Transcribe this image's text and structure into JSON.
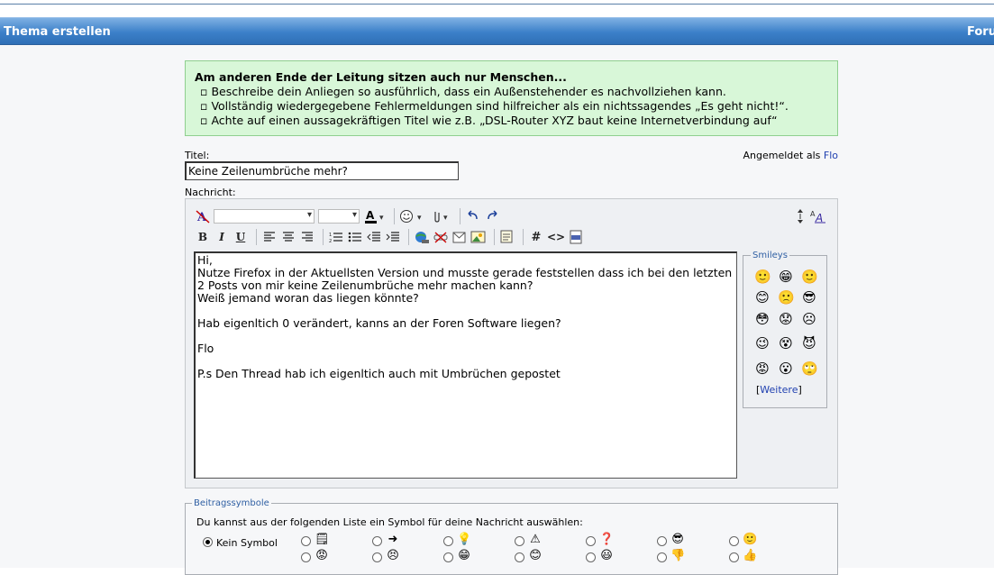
{
  "window": {
    "title": "Thema erstellen",
    "right_tab": "Foru"
  },
  "notice": {
    "heading": "Am anderen Ende der Leitung sitzen auch nur Menschen...",
    "items": [
      "Beschreibe dein Anliegen so ausführlich, dass ein Außenstehender es nachvollziehen kann.",
      "Vollständig wiedergegebene Fehlermeldungen sind hilfreicher als ein nichtssagendes „Es geht nicht!“.",
      "Achte auf einen aussagekräftigen Titel wie z.B. „DSL-Router XYZ baut keine Internetverbindung auf“"
    ]
  },
  "form": {
    "title_label": "Titel:",
    "title_value": "Keine Zeilenumbrüche mehr?",
    "message_label": "Nachricht:",
    "logged_in_prefix": "Angemeldet als",
    "logged_in_user": "Flo"
  },
  "toolbar": {
    "bold": "B",
    "italic": "I",
    "underline": "U",
    "hash": "#",
    "code": "<>"
  },
  "message_text": "Hi,\nNutze Firefox in der Aktuellsten Version und musste gerade feststellen dass ich bei den letzten 2 Posts von mir keine Zeilenumbrüche mehr machen kann?\nWeiß jemand woran das liegen könnte?\n\nHab eigenltich 0 verändert, kanns an der Foren Software liegen?\n\nFlo\n\nP.s Den Thread hab ich eigenltich auch mit Umbrüchen gepostet",
  "smileys": {
    "legend": "Smileys",
    "more_open": "[",
    "more_link": "Weitere",
    "more_close": "]",
    "icons": [
      "smile-icon",
      "grin-icon",
      "smile-icon",
      "smile-icon",
      "sad-icon",
      "cool-icon",
      "big-eyes-icon",
      "worried-icon",
      "frown-icon",
      "wink-icon",
      "eek-icon",
      "devil-icon",
      "angry-icon",
      "surprised-icon",
      "eyes-icon"
    ]
  },
  "symbols": {
    "legend": "Beitragssymbole",
    "description": "Du kannst aus der folgenden Liste ein Symbol für deine Nachricht auswählen:",
    "none_label": "Kein Symbol"
  }
}
